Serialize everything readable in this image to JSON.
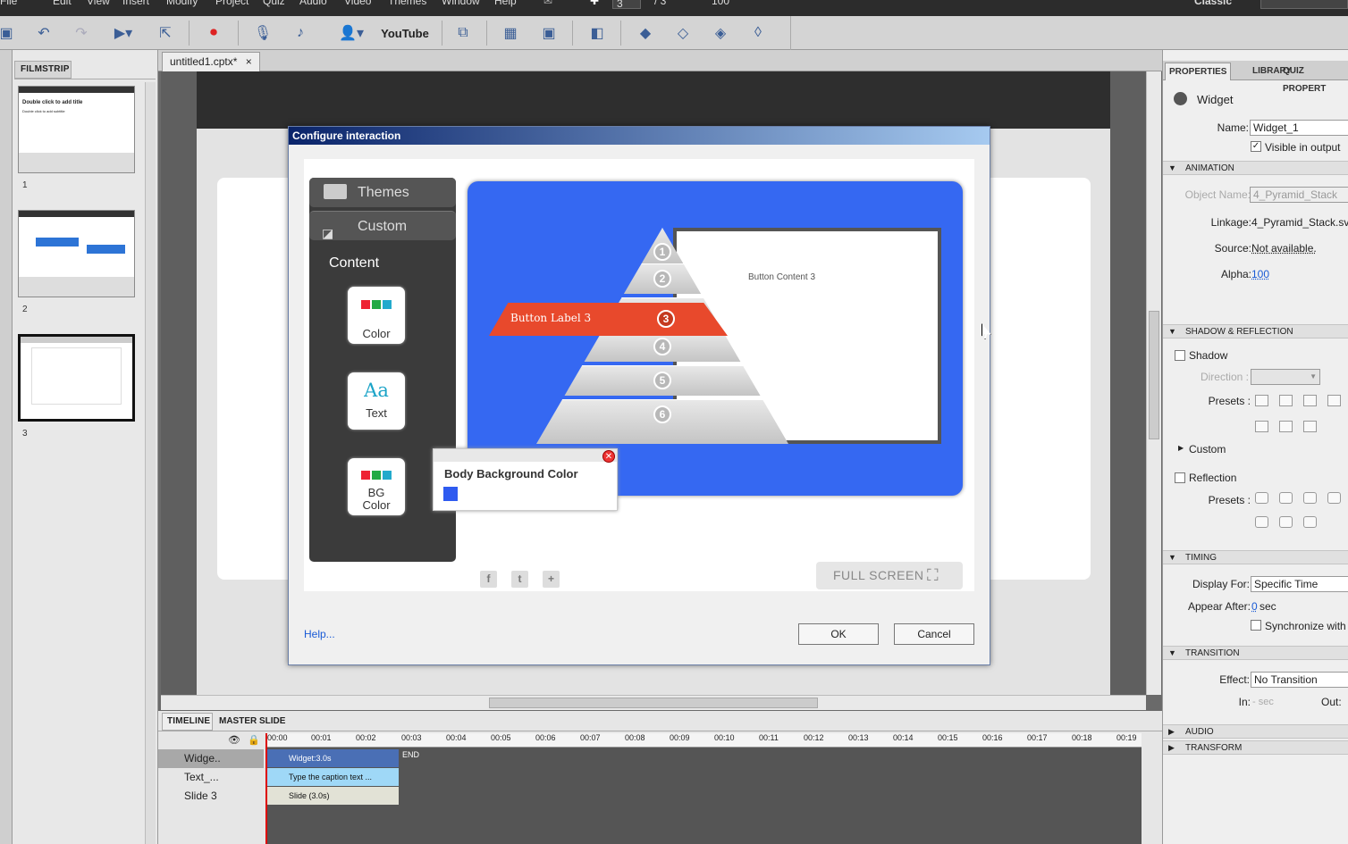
{
  "menu": [
    "File",
    "Edit",
    "View",
    "Insert",
    "Modify",
    "Project",
    "Quiz",
    "Audio",
    "Video",
    "Themes",
    "Window",
    "Help"
  ],
  "toolbar_extra": {
    "slide_current": "3",
    "slide_total": "/ 3",
    "zoom": "100",
    "workspace": "Classic"
  },
  "toolbar": {
    "youtube_label": "YouTube"
  },
  "filmstrip": {
    "title": "FILMSTRIP",
    "slides": [
      {
        "num": "1",
        "title": "Double click to add title",
        "subtitle": "Double click to add subtitle"
      },
      {
        "num": "2"
      },
      {
        "num": "3"
      }
    ]
  },
  "document": {
    "tab": "untitled1.cptx*",
    "tab_close": "×"
  },
  "dialog": {
    "title": "Configure interaction",
    "themes_label": "Themes",
    "custom_label": "Custom",
    "content_label": "Content",
    "tiles": [
      {
        "label": "Color"
      },
      {
        "label": "Text",
        "glyph": "Aa"
      },
      {
        "label": "BG\nColor"
      }
    ],
    "pyramid": {
      "levels": [
        "1",
        "2",
        "3",
        "4",
        "5",
        "6"
      ],
      "selected_label": "Button Label 3",
      "content": "Button Content 3"
    },
    "popup": {
      "title": "Body Background Color",
      "swatch": "#2f5bf0"
    },
    "fullscreen": "FULL SCREEN",
    "social": [
      "f",
      "t",
      "+"
    ],
    "help": "Help...",
    "ok": "OK",
    "cancel": "Cancel"
  },
  "timeline": {
    "tabs": [
      "TIMELINE",
      "MASTER SLIDE"
    ],
    "ticks": [
      "00:00",
      "00:01",
      "00:02",
      "00:03",
      "00:04",
      "00:05",
      "00:06",
      "00:07",
      "00:08",
      "00:09",
      "00:10",
      "00:11",
      "00:12",
      "00:13",
      "00:14",
      "00:15",
      "00:16",
      "00:17",
      "00:18",
      "00:19"
    ],
    "rows": [
      {
        "name": "Widge..",
        "bar": "Widget:3.0s"
      },
      {
        "name": "Text_...",
        "bar": "Type the caption text ..."
      },
      {
        "name": "Slide 3",
        "bar": "Slide (3.0s)"
      }
    ],
    "end": "END"
  },
  "properties": {
    "tabs": [
      "PROPERTIES",
      "LIBRARY",
      "QUIZ PROPERT"
    ],
    "type": "Widget",
    "name_label": "Name:",
    "name_value": "Widget_1",
    "visible_label": "Visible in output",
    "animation": "ANIMATION",
    "object_name_label": "Object Name:",
    "object_name_value": "4_Pyramid_Stack",
    "linkage_label": "Linkage:",
    "linkage_value": "4_Pyramid_Stack.sv",
    "source_label": "Source:",
    "source_value": "Not available.",
    "alpha_label": "Alpha:",
    "alpha_value": "100",
    "shadow_reflection": "SHADOW & REFLECTION",
    "shadow_label": "Shadow",
    "direction_label": "Direction :",
    "presets_label": "Presets :",
    "custom_label": "Custom",
    "reflection_label": "Reflection",
    "timing": "TIMING",
    "display_for_label": "Display For:",
    "display_for_value": "Specific Time",
    "appear_after_label": "Appear After:",
    "appear_after_value": "0",
    "appear_after_unit": "sec",
    "sync_label": "Synchronize with",
    "transition": "TRANSITION",
    "effect_label": "Effect:",
    "effect_value": "No Transition",
    "in_label": "In:",
    "in_value": "- sec",
    "out_label": "Out:",
    "audio": "AUDIO",
    "transform": "TRANSFORM"
  }
}
